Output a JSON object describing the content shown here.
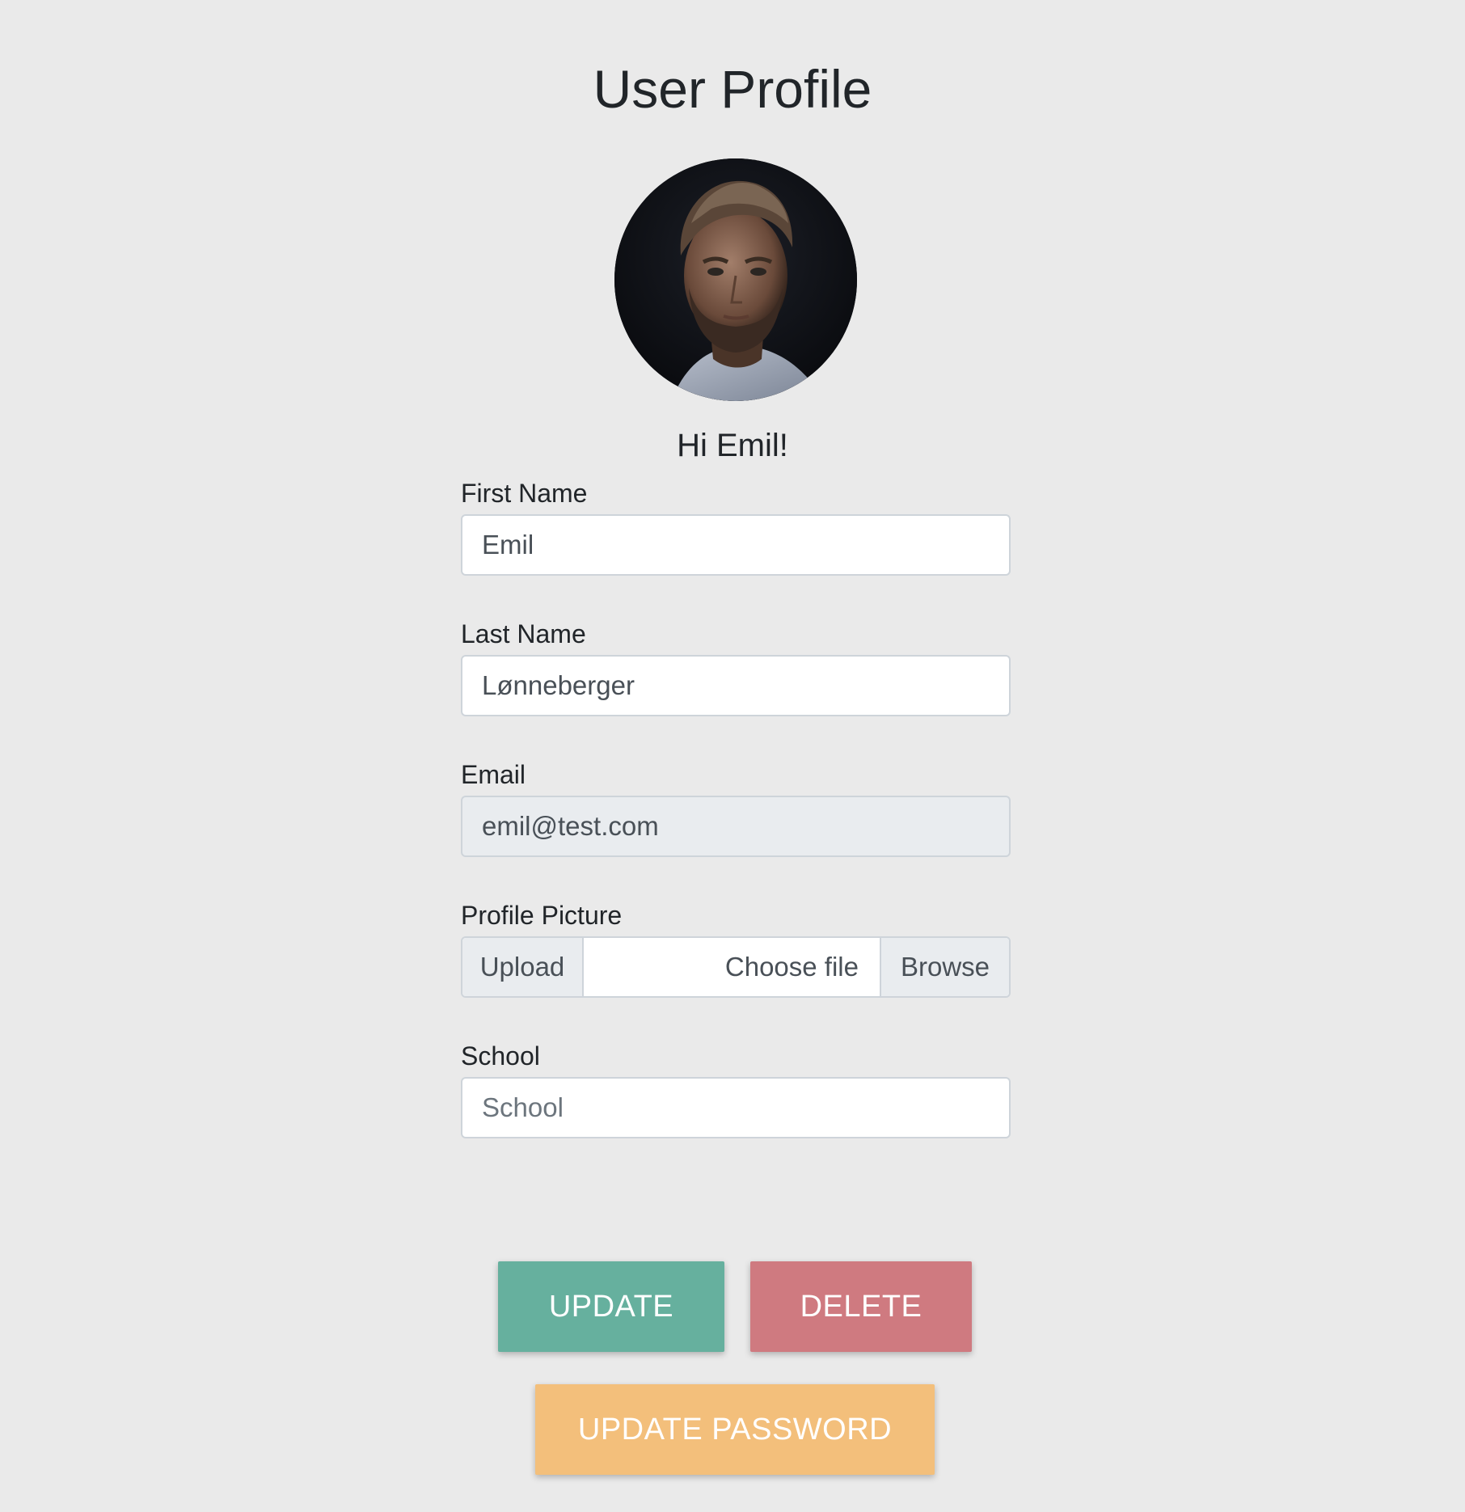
{
  "page": {
    "title": "User Profile",
    "greeting": "Hi Emil!"
  },
  "avatar": {
    "alt": "Profile picture"
  },
  "form": {
    "first_name": {
      "label": "First Name",
      "value": "Emil"
    },
    "last_name": {
      "label": "Last Name",
      "value": "Lønneberger"
    },
    "email": {
      "label": "Email",
      "value": "emil@test.com"
    },
    "profile_picture": {
      "label": "Profile Picture",
      "prepend": "Upload",
      "file_text": "Choose file",
      "browse": "Browse"
    },
    "school": {
      "label": "School",
      "placeholder": "School",
      "value": ""
    }
  },
  "actions": {
    "update": "UPDATE",
    "delete": "DELETE",
    "update_password": "UPDATE PASSWORD"
  },
  "colors": {
    "background": "#eaeaea",
    "update": "#66b09e",
    "delete": "#cf7a80",
    "update_password": "#f3bf7b"
  }
}
